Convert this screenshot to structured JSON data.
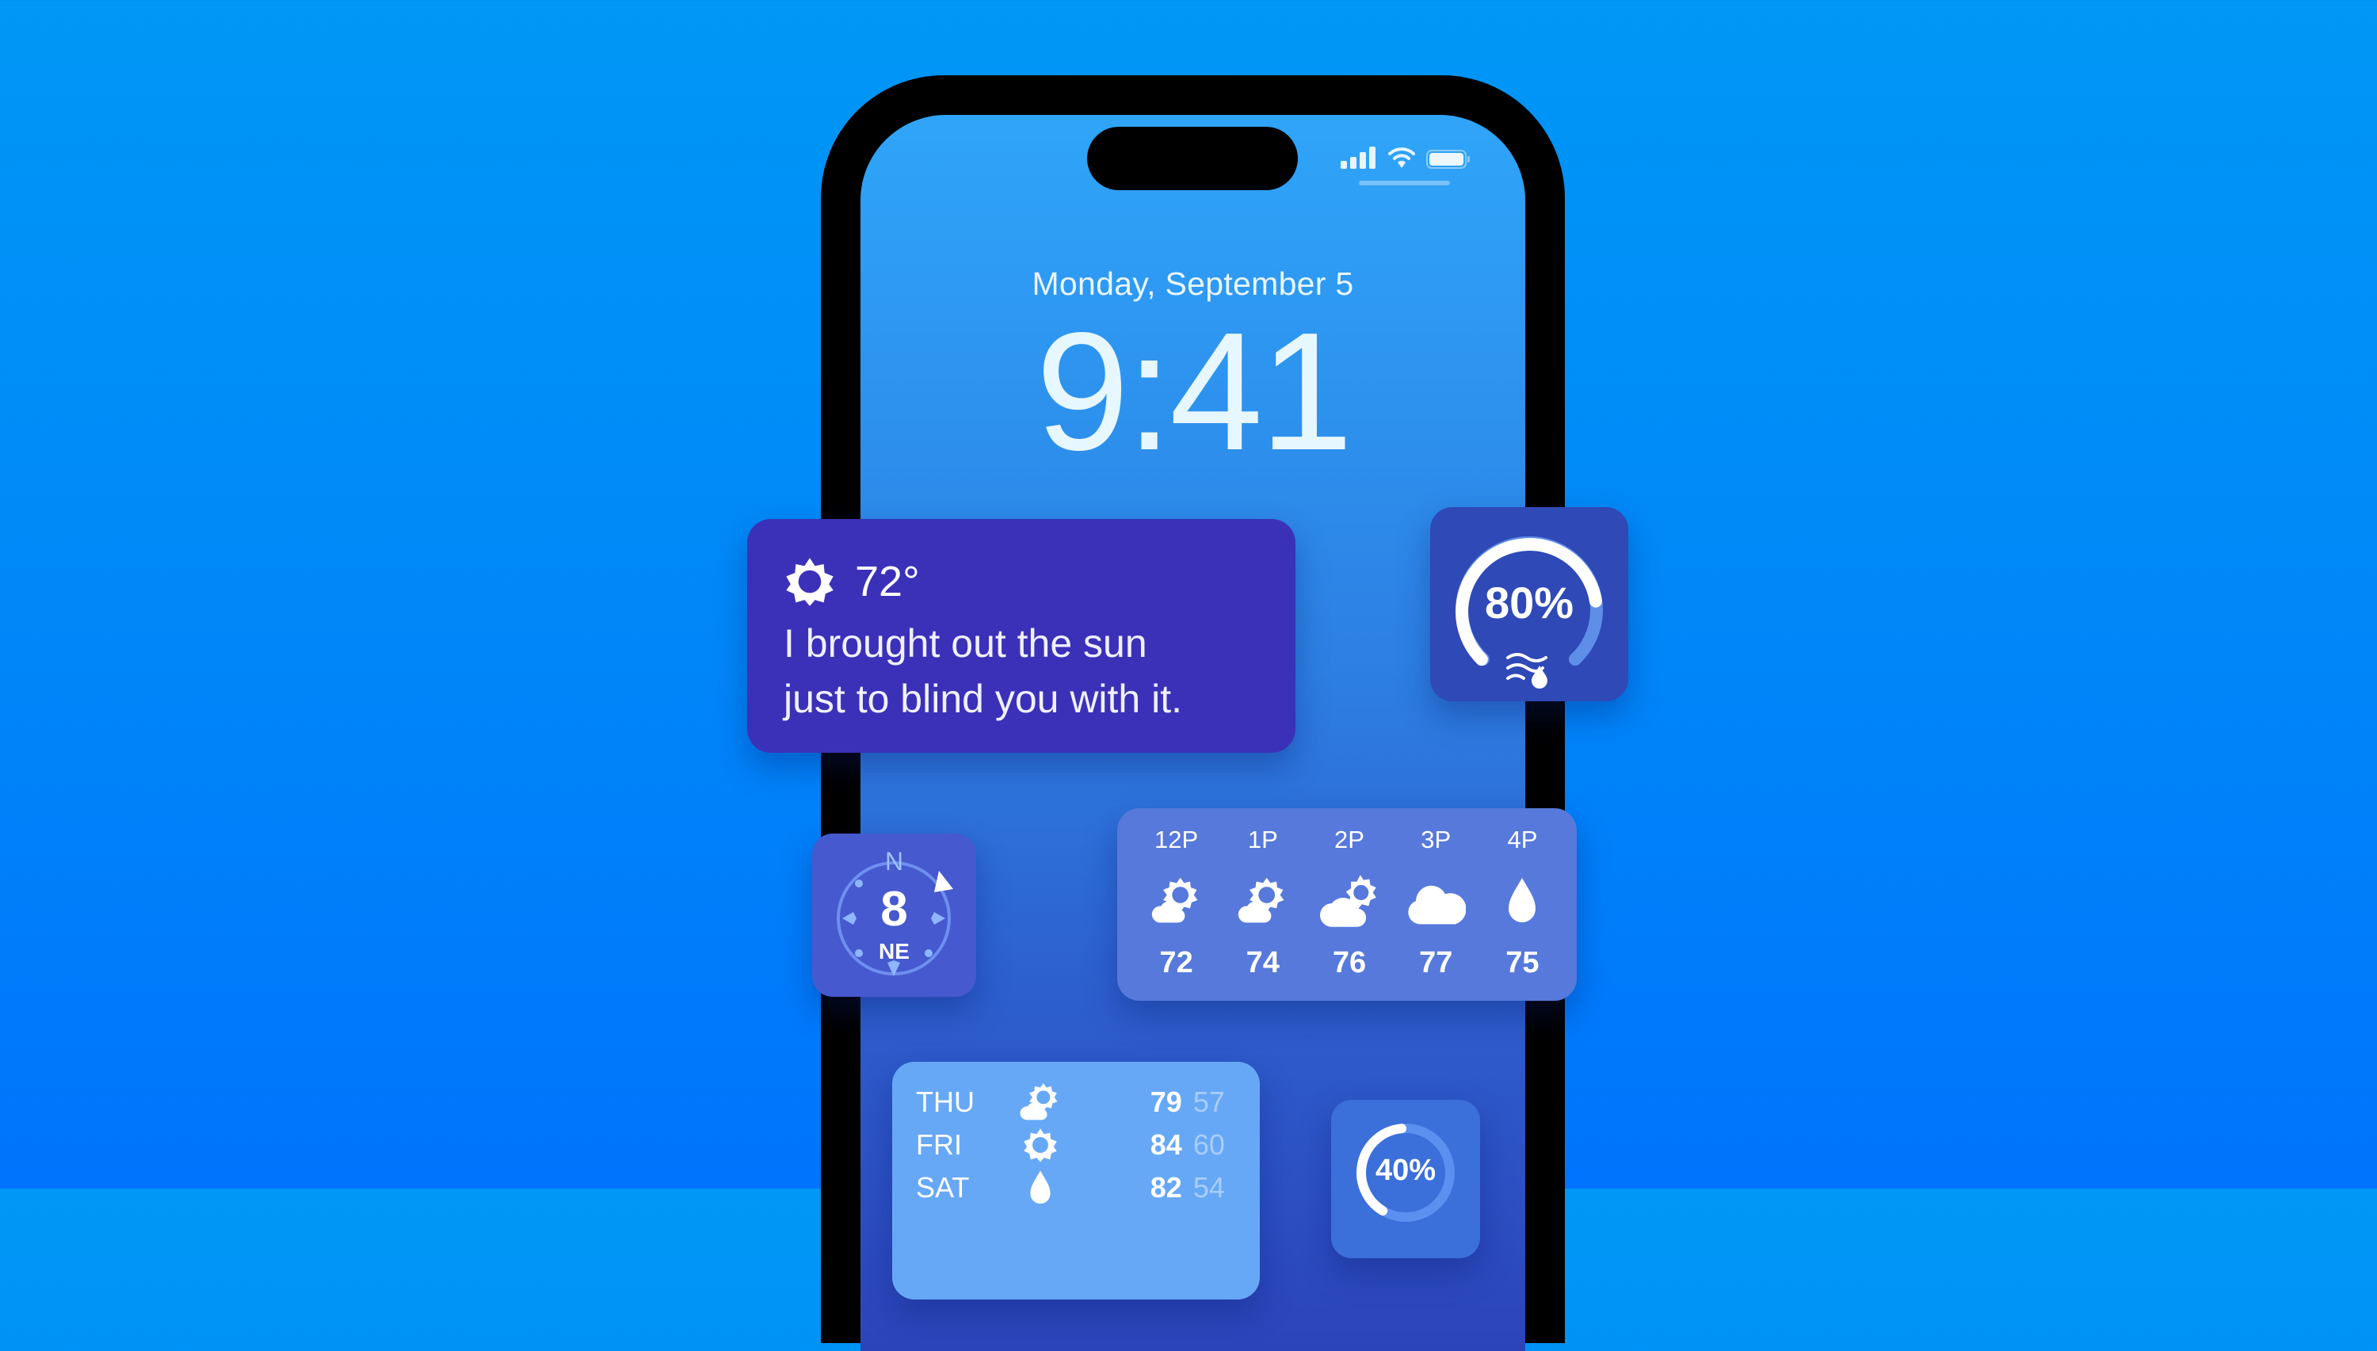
{
  "lock_screen": {
    "date": "Monday, September 5",
    "time": "9:41",
    "status_bar": {
      "icons": [
        "cellular-signal-icon",
        "wifi-icon",
        "battery-icon"
      ]
    }
  },
  "widgets": {
    "quote": {
      "icon": "sun-icon",
      "temperature": "72°",
      "message_line_1": "I brought out the sun",
      "message_line_2": "just to blind you with it."
    },
    "humidity": {
      "value": "80%",
      "fraction": 0.8,
      "icon": "humidity-icon"
    },
    "wind": {
      "north_label": "N",
      "speed": "8",
      "direction": "NE"
    },
    "hourly": {
      "hours": [
        {
          "time": "12P",
          "icon": "partly-sunny-icon",
          "temp": "72"
        },
        {
          "time": "1P",
          "icon": "partly-sunny-icon",
          "temp": "74"
        },
        {
          "time": "2P",
          "icon": "mostly-cloudy-icon",
          "temp": "76"
        },
        {
          "time": "3P",
          "icon": "cloud-icon",
          "temp": "77"
        },
        {
          "time": "4P",
          "icon": "rain-drop-icon",
          "temp": "75"
        }
      ]
    },
    "daily": {
      "days": [
        {
          "day": "THU",
          "icon": "partly-sunny-icon",
          "high": "79",
          "low": "57"
        },
        {
          "day": "FRI",
          "icon": "sun-icon",
          "high": "84",
          "low": "60"
        },
        {
          "day": "SAT",
          "icon": "rain-drop-icon",
          "high": "82",
          "low": "54"
        }
      ]
    },
    "precipitation": {
      "value": "40%",
      "fraction": 0.4
    }
  },
  "colors": {
    "background_top": "#0097f6",
    "background_bottom": "#0074fc",
    "quote_widget": "#3b31b8",
    "humidity_widget": "#2f49b7",
    "wind_widget": "#4659cf",
    "hourly_widget": "#5679db",
    "daily_widget": "#66a8f6"
  }
}
